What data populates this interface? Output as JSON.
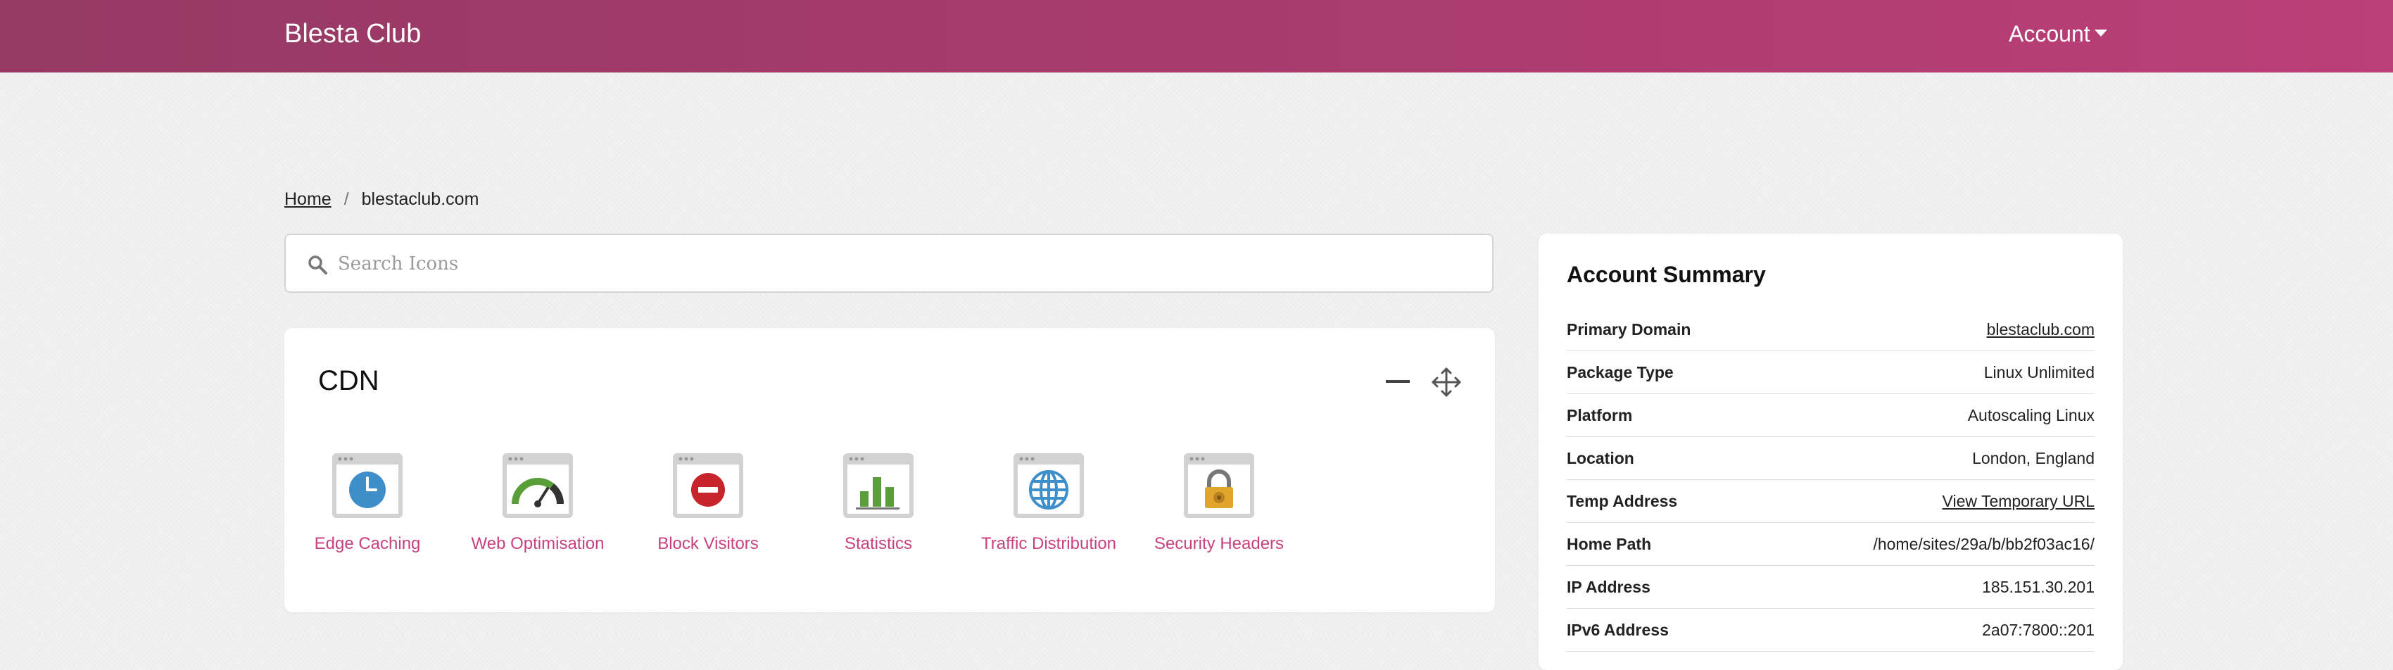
{
  "navbar": {
    "brand": "Blesta Club",
    "account": "Account"
  },
  "breadcrumb": {
    "home": "Home",
    "separator": "/",
    "current": "blestaclub.com"
  },
  "search": {
    "placeholder": "Search Icons",
    "value": ""
  },
  "cdn": {
    "title": "CDN",
    "tiles": [
      {
        "label": "Edge Caching",
        "icon": "clock-icon"
      },
      {
        "label": "Web Optimisation",
        "icon": "speedometer-icon"
      },
      {
        "label": "Block Visitors",
        "icon": "no-entry-icon"
      },
      {
        "label": "Statistics",
        "icon": "bar-chart-icon"
      },
      {
        "label": "Traffic Distribution",
        "icon": "globe-icon"
      },
      {
        "label": "Security Headers",
        "icon": "padlock-icon"
      }
    ]
  },
  "summary": {
    "title": "Account Summary",
    "rows": [
      {
        "key": "Primary Domain",
        "value": "blestaclub.com"
      },
      {
        "key": "Package Type",
        "value": "Linux Unlimited"
      },
      {
        "key": "Platform",
        "value": "Autoscaling Linux"
      },
      {
        "key": "Location",
        "value": "London, England"
      },
      {
        "key": "Temp Address",
        "value": "View Temporary URL"
      },
      {
        "key": "Home Path",
        "value": "/home/sites/29a/b/bb2f03ac16/"
      },
      {
        "key": "IP Address",
        "value": "185.151.30.201"
      },
      {
        "key": "IPv6 Address",
        "value": "2a07:7800::201"
      }
    ]
  },
  "colors": {
    "navbar_start": "#963a64",
    "navbar_end": "#bb3f78",
    "accent_link": "#c9407f",
    "icon_blue": "#3e8ec9",
    "icon_red": "#c8242b",
    "icon_green": "#5a9e3a",
    "icon_gold": "#e0a52a"
  }
}
